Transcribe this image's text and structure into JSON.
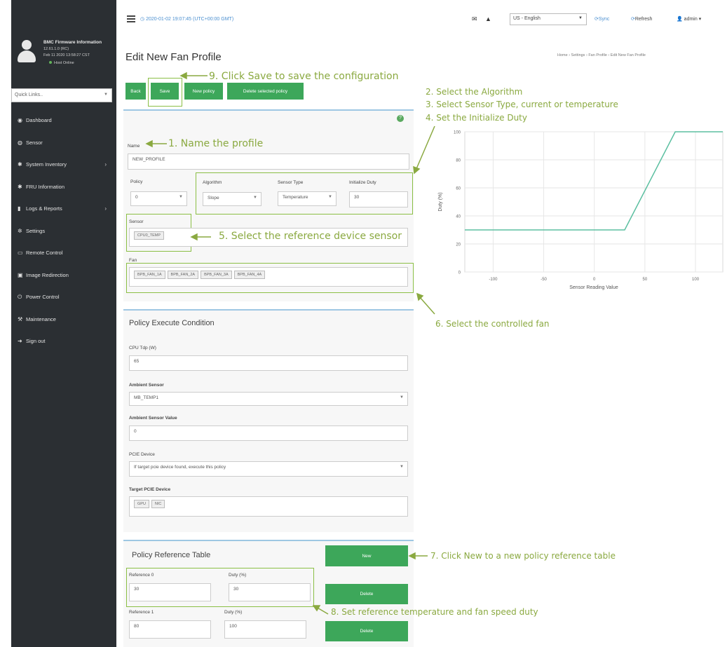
{
  "sidebar": {
    "bmc_title": "BMC Firmware Information",
    "bmc_version": "12.61.1.0 (RC)",
    "bmc_build": "Feb 11 2020 13:58:27 CST",
    "host_status": "Host Online",
    "quicklinks_placeholder": "Quick Links..",
    "items": [
      {
        "label": "Dashboard",
        "icon": "dashboard-icon"
      },
      {
        "label": "Sensor",
        "icon": "sensor-icon"
      },
      {
        "label": "System Inventory",
        "icon": "inventory-icon"
      },
      {
        "label": "FRU Information",
        "icon": "fru-icon"
      },
      {
        "label": "Logs & Reports",
        "icon": "logs-icon"
      },
      {
        "label": "Settings",
        "icon": "settings-icon"
      },
      {
        "label": "Remote Control",
        "icon": "monitor-icon"
      },
      {
        "label": "Image Redirection",
        "icon": "image-icon"
      },
      {
        "label": "Power Control",
        "icon": "power-icon"
      },
      {
        "label": "Maintenance",
        "icon": "wrench-icon"
      },
      {
        "label": "Sign out",
        "icon": "signout-icon"
      }
    ]
  },
  "topbar": {
    "datetime": "2020-01-02 19:07:45 (UTC+00:00 GMT)",
    "language": "US - English",
    "sync": "Sync",
    "refresh": "Refresh",
    "user": "admin"
  },
  "page": {
    "title": "Edit New Fan Profile",
    "breadcrumb": "Home  ›  Settings  ›  Fan Profile  ›  Edit New Fan Profile"
  },
  "buttons": {
    "back": "Back",
    "save": "Save",
    "new_policy": "New policy",
    "delete_selected": "Delete selected policy",
    "new": "New",
    "delete": "Delete"
  },
  "form": {
    "name_label": "Name",
    "name_value": "NEW_PROFILE",
    "policy_label": "Policy",
    "policy_value": "0",
    "algorithm_label": "Algorithm",
    "algorithm_value": "Slope",
    "sensor_type_label": "Sensor Type",
    "sensor_type_value": "Temperature",
    "init_duty_label": "Initialize Duty",
    "init_duty_value": "30",
    "sensor_label": "Sensor",
    "sensor_tag": "CPU0_TEMP",
    "fan_label": "Fan",
    "fan_tags": [
      "BPB_FAN_1A",
      "BPB_FAN_2A",
      "BPB_FAN_3A",
      "BPB_FAN_4A"
    ]
  },
  "condition": {
    "title": "Policy Execute Condition",
    "cpu_tdp_label": "CPU Tdp (W)",
    "cpu_tdp_value": "65",
    "ambient_sensor_label": "Ambient Sensor",
    "ambient_sensor_value": "MB_TEMP1",
    "ambient_value_label": "Ambient Sensor Value",
    "ambient_value": "0",
    "pcie_label": "PCIE Device",
    "pcie_value": "If target pcie device found, execute this policy",
    "target_pcie_label": "Target PCIE Device",
    "target_pcie_tags": [
      "GPU",
      "NIC"
    ]
  },
  "reference": {
    "title": "Policy Reference Table",
    "rows": [
      {
        "ref_label": "Reference 0",
        "ref_value": "30",
        "duty_label": "Duty (%)",
        "duty_value": "30"
      },
      {
        "ref_label": "Reference 1",
        "ref_value": "80",
        "duty_label": "Duty (%)",
        "duty_value": "100"
      }
    ]
  },
  "annotations": {
    "a1": "1. Name the profile",
    "a2": "2. Select the Algorithm",
    "a3": "3. Select Sensor Type, current or temperature",
    "a4": "4. Set the Initialize Duty",
    "a5": "5. Select the reference device sensor",
    "a6": "6. Select the controlled fan",
    "a7": "7. Click New to a new policy reference table",
    "a8": "8. Set reference temperature and fan speed duty",
    "a9": "9. Click Save to save the configuration"
  },
  "colors": {
    "sidebar": "#2b2f33",
    "button_green": "#3da75a",
    "annotation": "#8aa940",
    "chart_line": "#5bbfa0"
  },
  "chart_data": {
    "type": "line",
    "xlabel": "Sensor Reading Value",
    "ylabel": "Duty (%)",
    "xlim": [
      -128,
      127
    ],
    "ylim": [
      0,
      100
    ],
    "x_ticks": [
      -100,
      -50,
      0,
      50,
      100
    ],
    "y_ticks": [
      0,
      20,
      40,
      60,
      80,
      100
    ],
    "grid": true,
    "series": [
      {
        "x": [
          -128,
          30,
          80,
          127
        ],
        "y": [
          30,
          30,
          100,
          100
        ]
      }
    ]
  }
}
